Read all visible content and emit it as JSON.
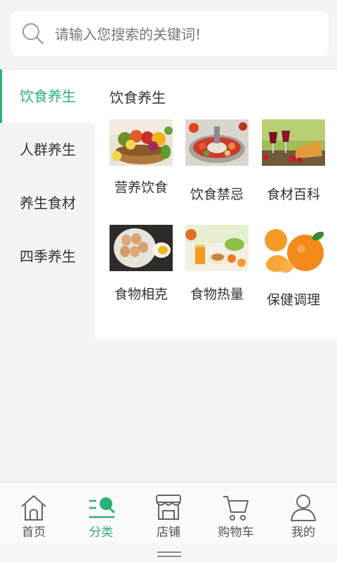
{
  "search": {
    "placeholder": "请输入您搜索的关键词!"
  },
  "sidebar": {
    "items": [
      {
        "label": "饮食养生",
        "active": true
      },
      {
        "label": "人群养生",
        "active": false
      },
      {
        "label": "养生食材",
        "active": false
      },
      {
        "label": "四季养生",
        "active": false
      }
    ]
  },
  "main": {
    "title": "饮食养生",
    "items": [
      {
        "label": "营养饮食"
      },
      {
        "label": "饮食禁忌"
      },
      {
        "label": "食材百科"
      },
      {
        "label": "食物相克"
      },
      {
        "label": "食物热量"
      },
      {
        "label": "保健调理"
      }
    ]
  },
  "bottom_nav": {
    "items": [
      {
        "label": "首页",
        "icon": "home-icon"
      },
      {
        "label": "分类",
        "icon": "category-search-icon",
        "active": true
      },
      {
        "label": "店铺",
        "icon": "store-icon"
      },
      {
        "label": "购物车",
        "icon": "cart-icon"
      },
      {
        "label": "我的",
        "icon": "user-icon"
      }
    ]
  },
  "colors": {
    "accent": "#29b176",
    "text": "#333333",
    "background": "#f4f4f7"
  }
}
